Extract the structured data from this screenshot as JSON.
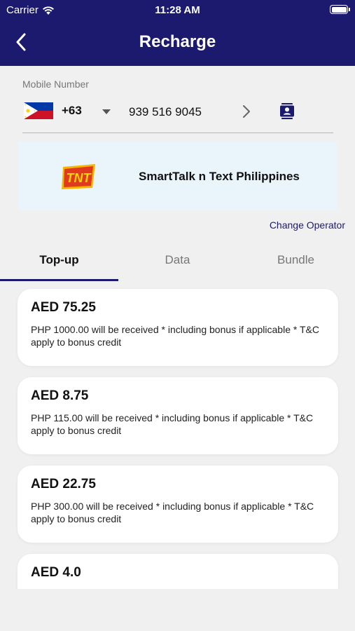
{
  "status": {
    "carrier": "Carrier",
    "time": "11:28 AM"
  },
  "header": {
    "title": "Recharge"
  },
  "mobile": {
    "label": "Mobile Number",
    "country_code": "+63",
    "number": "939 516 9045"
  },
  "operator": {
    "name": "SmartTalk n Text Philippines",
    "logo_text": "TNT",
    "change_label": "Change Operator"
  },
  "tabs": [
    {
      "label": "Top-up",
      "active": true
    },
    {
      "label": "Data",
      "active": false
    },
    {
      "label": "Bundle",
      "active": false
    }
  ],
  "plans": [
    {
      "amount": "AED 75.25",
      "desc": "PHP 1000.00 will be received * including bonus if applicable * T&C apply to bonus credit"
    },
    {
      "amount": "AED 8.75",
      "desc": "PHP 115.00 will be received * including bonus if applicable * T&C apply to bonus credit"
    },
    {
      "amount": "AED 22.75",
      "desc": "PHP 300.00 will be received * including bonus if applicable * T&C apply to bonus credit"
    },
    {
      "amount": "AED 4.0",
      "desc": ""
    }
  ],
  "colors": {
    "primary": "#1c1a6e",
    "background": "#f0f0f0",
    "operator_bg": "#eaf4fb"
  }
}
